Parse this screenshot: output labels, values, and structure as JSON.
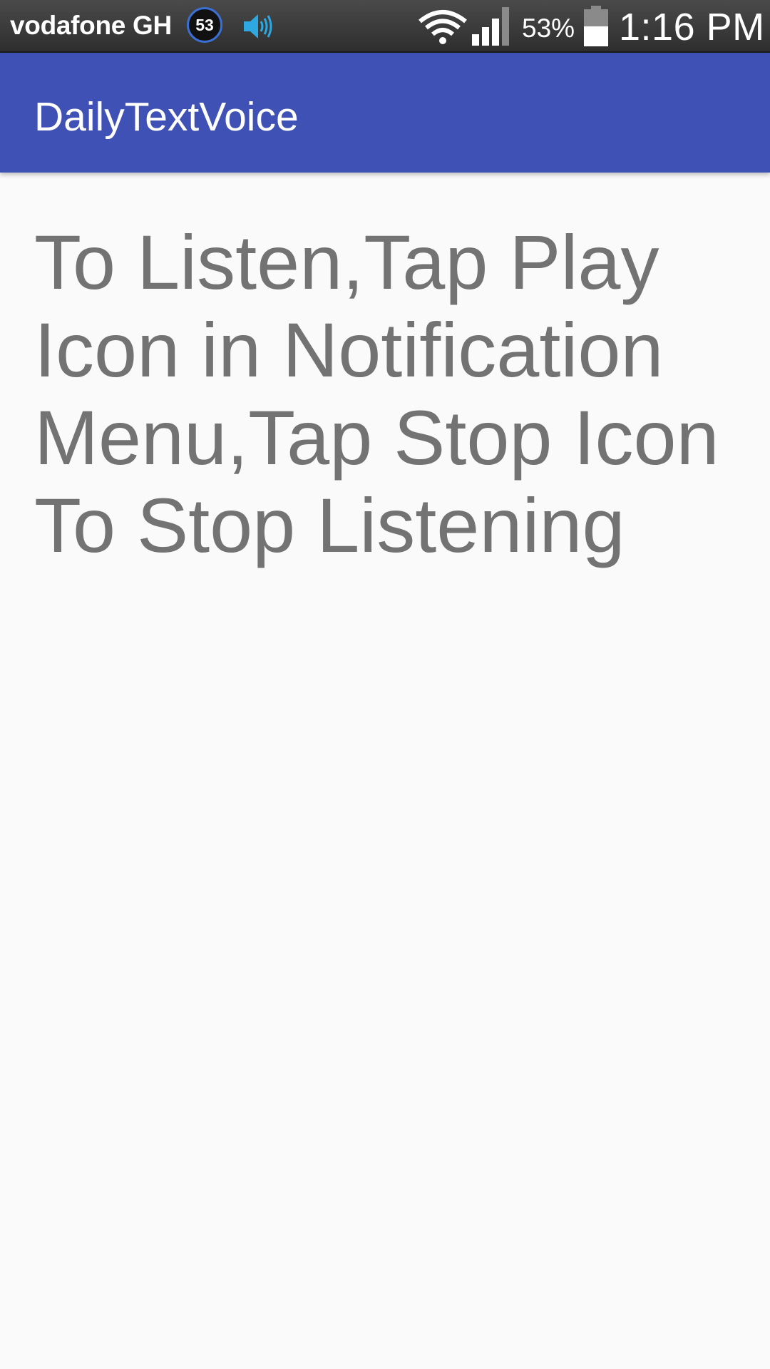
{
  "status_bar": {
    "carrier": "vodafone GH",
    "badge_count": "53",
    "speaker_icon": "speaker-icon",
    "wifi_icon": "wifi-icon",
    "signal_icon": "signal-icon",
    "battery_percent": "53%",
    "battery_level": 0.53,
    "battery_icon": "battery-icon",
    "time": "1:16 PM"
  },
  "app_bar": {
    "title": "DailyTextVoice",
    "color": "#3f51b5"
  },
  "content": {
    "instructions": "To Listen,Tap Play Icon in Notification Menu,Tap Stop Icon To Stop Listening",
    "text_color": "#737373"
  },
  "colors": {
    "background": "#fafafa",
    "speaker_accent": "#2ea8e0",
    "badge_ring": "#3b6fd4"
  }
}
